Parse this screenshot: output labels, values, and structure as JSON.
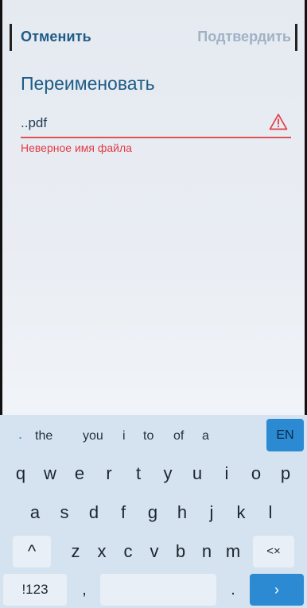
{
  "header": {
    "cancel_label": "Отменить",
    "confirm_label": "Подтвердить"
  },
  "dialog": {
    "title": "Переименовать",
    "filename_value": "..pdf",
    "error_text": "Неверное имя файла"
  },
  "keyboard": {
    "suggestions": [
      "the",
      "you",
      "i",
      "to",
      "of",
      "a"
    ],
    "suggestion_prefix": ".",
    "language_label": "EN",
    "row1": [
      "q",
      "w",
      "e",
      "r",
      "t",
      "y",
      "u",
      "i",
      "o",
      "p"
    ],
    "row2": [
      "a",
      "s",
      "d",
      "f",
      "g",
      "h",
      "j",
      "k",
      "l"
    ],
    "row3": [
      "z",
      "x",
      "c",
      "v",
      "b",
      "n",
      "m"
    ],
    "shift_label": "^",
    "backspace_label": "<×",
    "symbols_label": "!123",
    "comma_label": ",",
    "period_label": ".",
    "enter_label": "›"
  },
  "colors": {
    "accent": "#1f5c86",
    "error": "#e23b44",
    "keyboard_bg": "#d4e3ef",
    "key_highlight": "#2b8ad2"
  }
}
